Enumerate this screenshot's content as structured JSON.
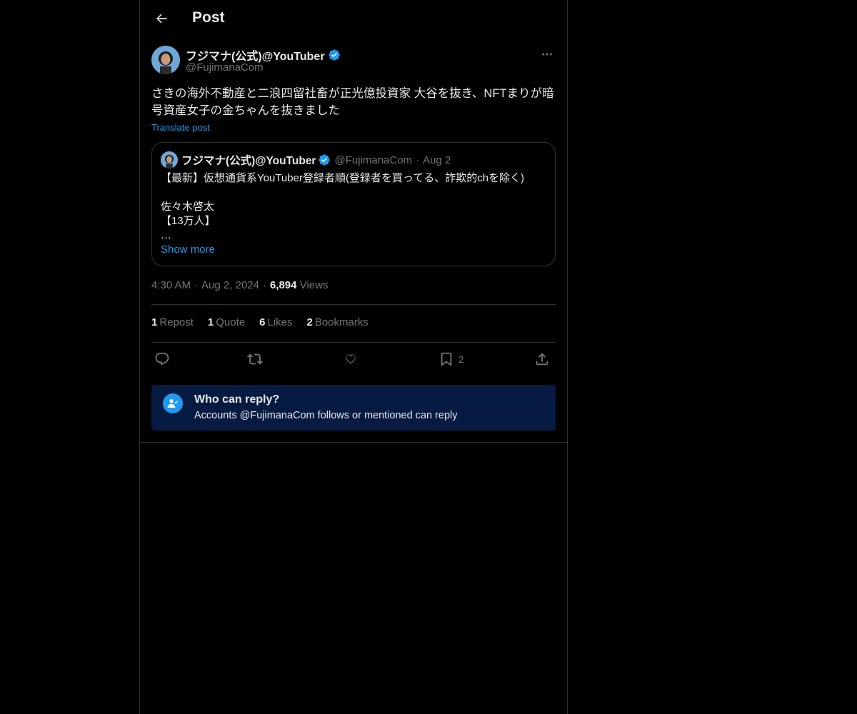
{
  "header": {
    "title": "Post"
  },
  "author": {
    "name": "フジマナ(公式)@YouTuber",
    "handle": "@FujimanaCom"
  },
  "post": {
    "text": "さきの海外不動産と二浪四留社畜が正光億投資家 大谷を抜き、NFTまりが暗号資産女子の金ちゃんを抜きました",
    "translate_label": "Translate post"
  },
  "quote": {
    "name": "フジマナ(公式)@YouTuber",
    "handle": "@FujimanaCom",
    "dot": "·",
    "date": "Aug 2",
    "body": "【最新】仮想通貨系YouTuber登録者順(登録者を買ってる、詐欺的chを除く)\n\n佐々木啓太\n【13万人】\n…",
    "show_more": "Show more"
  },
  "meta": {
    "time": "4:30 AM",
    "date": "Aug 2, 2024",
    "views_count": "6,894",
    "views_label": "Views",
    "separator": "·"
  },
  "stats": [
    {
      "count": "1",
      "label": "Repost"
    },
    {
      "count": "1",
      "label": "Quote"
    },
    {
      "count": "6",
      "label": "Likes"
    },
    {
      "count": "2",
      "label": "Bookmarks"
    }
  ],
  "actions": {
    "bookmark_count": "2"
  },
  "reply_restriction": {
    "title": "Who can reply?",
    "description": "Accounts @FujimanaCom follows or mentioned can reply"
  },
  "colors": {
    "accent": "#1d9bf0",
    "background": "#000000",
    "muted": "#71767b",
    "border": "#2f3336",
    "reply_box": "#061a42"
  },
  "icons": [
    "arrow-left-icon",
    "verified-badge-icon",
    "more-horizontal-icon",
    "reply-icon",
    "repost-icon",
    "like-icon",
    "bookmark-icon",
    "share-icon",
    "person-check-icon"
  ]
}
